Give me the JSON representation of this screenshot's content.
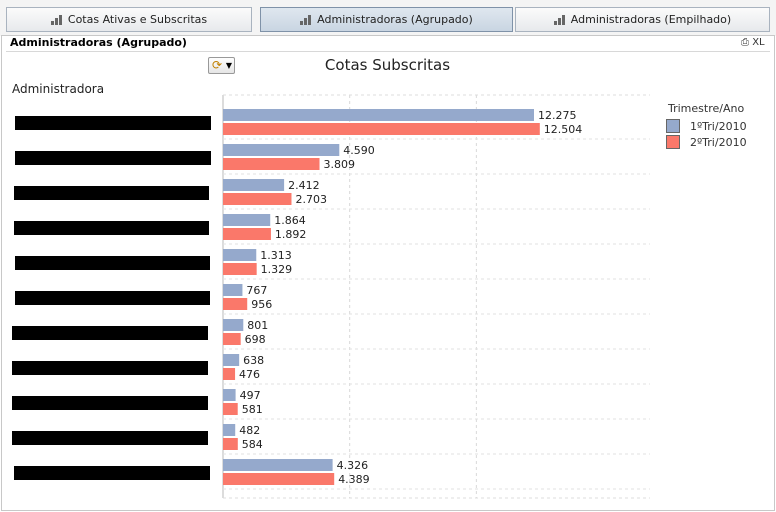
{
  "tabs": [
    {
      "label": "Cotas Ativas e Subscritas",
      "active": false
    },
    {
      "label": "Administradoras (Agrupado)",
      "active": true
    },
    {
      "label": "Administradoras (Empilhado)",
      "active": false
    }
  ],
  "panel": {
    "title": "Administradoras (Agrupado)",
    "xl_label": "XL"
  },
  "chart_data": {
    "type": "bar",
    "orientation": "horizontal",
    "title": "Cotas Subscritas",
    "dimension_label": "Administradora",
    "categories": [
      "",
      "",
      "",
      "",
      "",
      "",
      "",
      "",
      "",
      "",
      ""
    ],
    "categories_redacted": true,
    "legend_title": "Trimestre/Ano",
    "legend_placement": "right",
    "grid": true,
    "xlim": [
      0,
      14000
    ],
    "series": [
      {
        "name": "1ºTri/2010",
        "color": "#95a9cc",
        "values": [
          12275,
          4590,
          2412,
          1864,
          1313,
          767,
          801,
          638,
          497,
          482,
          4326
        ],
        "labels": [
          "12.275",
          "4.590",
          "2.412",
          "1.864",
          "1.313",
          "767",
          "801",
          "638",
          "497",
          "482",
          "4.326"
        ]
      },
      {
        "name": "2ºTri/2010",
        "color": "#fa786a",
        "values": [
          12504,
          3809,
          2703,
          1892,
          1329,
          956,
          698,
          476,
          581,
          584,
          4389
        ],
        "labels": [
          "12.504",
          "3.809",
          "2.703",
          "1.892",
          "1.329",
          "956",
          "698",
          "476",
          "581",
          "584",
          "4.389"
        ]
      }
    ]
  }
}
